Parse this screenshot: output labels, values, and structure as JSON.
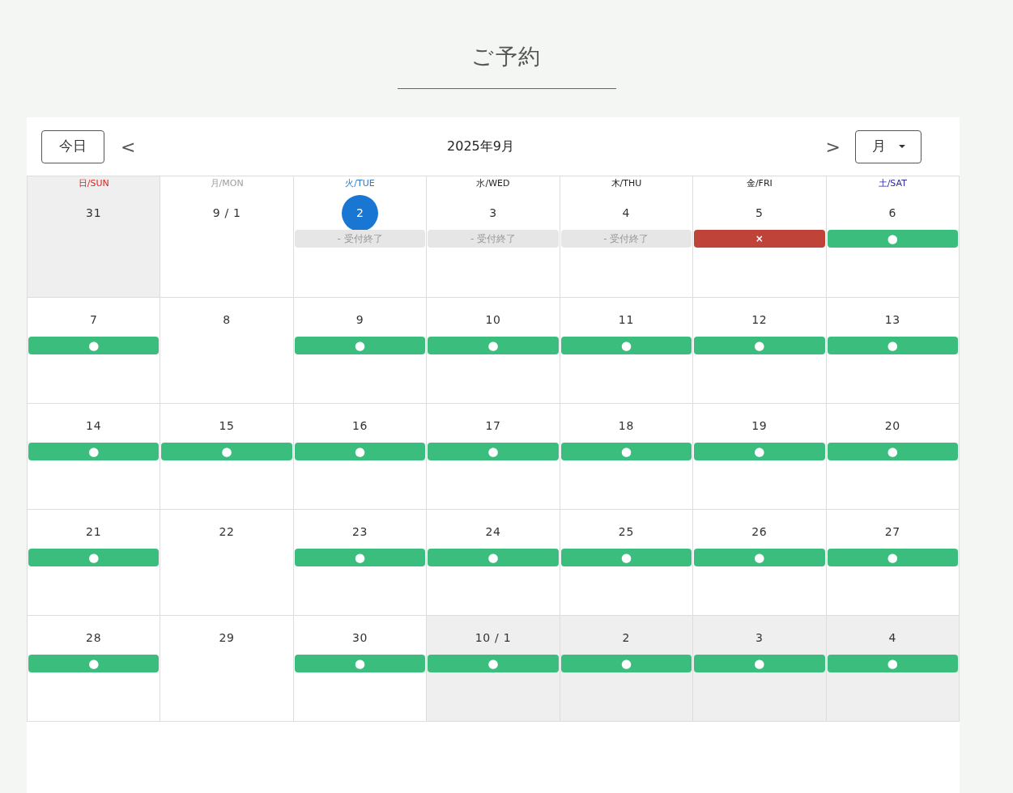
{
  "page_title": "ご予約",
  "toolbar": {
    "today_button": "今日",
    "prev_button": "<",
    "month_label": "2025年9月",
    "next_button": ">",
    "view_select": "月"
  },
  "weekdays": [
    {
      "label": "日/SUN",
      "color": "#e0211f"
    },
    {
      "label": "月/MON",
      "color": "#9e9e9e"
    },
    {
      "label": "火/TUE",
      "color": "#2a7bc8"
    },
    {
      "label": "水/WED",
      "color": "#222222"
    },
    {
      "label": "木/THU",
      "color": "#222222"
    },
    {
      "label": "金/FRI",
      "color": "#222222"
    },
    {
      "label": "土/SAT",
      "color": "#2a2aa8"
    }
  ],
  "weeks": [
    [
      {
        "date": "31",
        "muted": true,
        "selected": false
      },
      {
        "date": "9 / 1",
        "muted": false,
        "selected": false
      },
      {
        "date": "2",
        "muted": false,
        "selected": true,
        "slot": {
          "kind": "closed",
          "label": "- 受付終了"
        }
      },
      {
        "date": "3",
        "muted": false,
        "selected": false,
        "slot": {
          "kind": "closed",
          "label": "- 受付終了"
        }
      },
      {
        "date": "4",
        "muted": false,
        "selected": false,
        "slot": {
          "kind": "closed",
          "label": "- 受付終了"
        }
      },
      {
        "date": "5",
        "muted": false,
        "selected": false,
        "slot": {
          "kind": "full",
          "label": "×"
        }
      },
      {
        "date": "6",
        "muted": false,
        "selected": false,
        "slot": {
          "kind": "available",
          "label": "●"
        }
      }
    ],
    [
      {
        "date": "7",
        "muted": false,
        "selected": false,
        "slot": {
          "kind": "available",
          "label": "●"
        }
      },
      {
        "date": "8",
        "muted": false,
        "selected": false
      },
      {
        "date": "9",
        "muted": false,
        "selected": false,
        "slot": {
          "kind": "available",
          "label": "●"
        }
      },
      {
        "date": "10",
        "muted": false,
        "selected": false,
        "slot": {
          "kind": "available",
          "label": "●"
        }
      },
      {
        "date": "11",
        "muted": false,
        "selected": false,
        "slot": {
          "kind": "available",
          "label": "●"
        }
      },
      {
        "date": "12",
        "muted": false,
        "selected": false,
        "slot": {
          "kind": "available",
          "label": "●"
        }
      },
      {
        "date": "13",
        "muted": false,
        "selected": false,
        "slot": {
          "kind": "available",
          "label": "●"
        }
      }
    ],
    [
      {
        "date": "14",
        "muted": false,
        "selected": false,
        "slot": {
          "kind": "available",
          "label": "●"
        }
      },
      {
        "date": "15",
        "muted": false,
        "selected": false,
        "slot": {
          "kind": "available",
          "label": "●"
        }
      },
      {
        "date": "16",
        "muted": false,
        "selected": false,
        "slot": {
          "kind": "available",
          "label": "●"
        }
      },
      {
        "date": "17",
        "muted": false,
        "selected": false,
        "slot": {
          "kind": "available",
          "label": "●"
        }
      },
      {
        "date": "18",
        "muted": false,
        "selected": false,
        "slot": {
          "kind": "available",
          "label": "●"
        }
      },
      {
        "date": "19",
        "muted": false,
        "selected": false,
        "slot": {
          "kind": "available",
          "label": "●"
        }
      },
      {
        "date": "20",
        "muted": false,
        "selected": false,
        "slot": {
          "kind": "available",
          "label": "●"
        }
      }
    ],
    [
      {
        "date": "21",
        "muted": false,
        "selected": false,
        "slot": {
          "kind": "available",
          "label": "●"
        }
      },
      {
        "date": "22",
        "muted": false,
        "selected": false
      },
      {
        "date": "23",
        "muted": false,
        "selected": false,
        "slot": {
          "kind": "available",
          "label": "●"
        }
      },
      {
        "date": "24",
        "muted": false,
        "selected": false,
        "slot": {
          "kind": "available",
          "label": "●"
        }
      },
      {
        "date": "25",
        "muted": false,
        "selected": false,
        "slot": {
          "kind": "available",
          "label": "●"
        }
      },
      {
        "date": "26",
        "muted": false,
        "selected": false,
        "slot": {
          "kind": "available",
          "label": "●"
        }
      },
      {
        "date": "27",
        "muted": false,
        "selected": false,
        "slot": {
          "kind": "available",
          "label": "●"
        }
      }
    ],
    [
      {
        "date": "28",
        "muted": false,
        "selected": false,
        "slot": {
          "kind": "available",
          "label": "●"
        }
      },
      {
        "date": "29",
        "muted": false,
        "selected": false
      },
      {
        "date": "30",
        "muted": false,
        "selected": false,
        "slot": {
          "kind": "available",
          "label": "●"
        }
      },
      {
        "date": "10 / 1",
        "muted": true,
        "selected": false,
        "slot": {
          "kind": "available",
          "label": "●"
        }
      },
      {
        "date": "2",
        "muted": true,
        "selected": false,
        "slot": {
          "kind": "available",
          "label": "●"
        }
      },
      {
        "date": "3",
        "muted": true,
        "selected": false,
        "slot": {
          "kind": "available",
          "label": "●"
        }
      },
      {
        "date": "4",
        "muted": true,
        "selected": false,
        "slot": {
          "kind": "available",
          "label": "●"
        }
      }
    ]
  ]
}
